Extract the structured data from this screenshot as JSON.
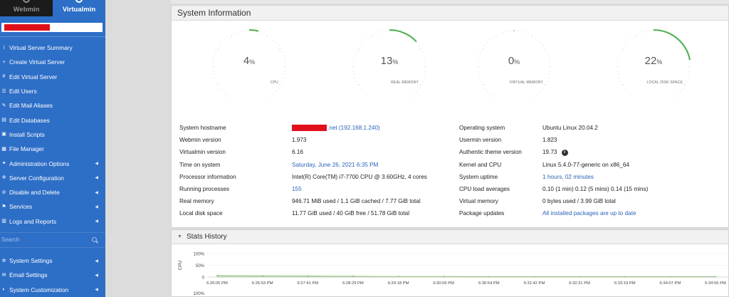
{
  "sidebar": {
    "tabs": [
      {
        "label": "Webmin",
        "active": false
      },
      {
        "label": "Virtualmin",
        "active": true
      }
    ],
    "items": [
      {
        "label": "Virtual Server Summary",
        "icon": "info-circle-icon",
        "arrow": false
      },
      {
        "label": "Create Virtual Server",
        "icon": "create-server-icon",
        "arrow": false
      },
      {
        "label": "Edit Virtual Server",
        "icon": "server-edit-icon",
        "arrow": false
      },
      {
        "label": "Edit Users",
        "icon": "users-icon",
        "arrow": false
      },
      {
        "label": "Edit Mail Aliases",
        "icon": "mail-alias-icon",
        "arrow": false
      },
      {
        "label": "Edit Databases",
        "icon": "database-icon",
        "arrow": false
      },
      {
        "label": "Install Scripts",
        "icon": "install-scripts-icon",
        "arrow": false
      },
      {
        "label": "File Manager",
        "icon": "file-manager-icon",
        "arrow": false
      },
      {
        "label": "Administration Options",
        "icon": "wrench-icon",
        "arrow": true
      },
      {
        "label": "Server Configuration",
        "icon": "cogs-icon",
        "arrow": true
      },
      {
        "label": "Disable and Delete",
        "icon": "delete-icon",
        "arrow": true
      },
      {
        "label": "Services",
        "icon": "services-icon",
        "arrow": true
      },
      {
        "label": "Logs and Reports",
        "icon": "logs-icon",
        "arrow": true
      }
    ],
    "search_placeholder": "Search",
    "bottom_items": [
      {
        "label": "System Settings",
        "icon": "gear-icon",
        "arrow": true
      },
      {
        "label": "Email Settings",
        "icon": "envelope-icon",
        "arrow": true
      },
      {
        "label": "System Customization",
        "icon": "palette-icon",
        "arrow": true
      }
    ]
  },
  "sysinfo": {
    "title": "System Information",
    "gauges": [
      {
        "label": "CPU",
        "value": 4,
        "unit": "%"
      },
      {
        "label": "REAL MEMORY",
        "value": 13,
        "unit": "%"
      },
      {
        "label": "VIRTUAL MEMORY",
        "value": 0,
        "unit": "%"
      },
      {
        "label": "LOCAL DISK SPACE",
        "value": 22,
        "unit": "%"
      }
    ],
    "left": [
      {
        "k": "System hostname",
        "v": ".net (192.168.1.240)",
        "link": true,
        "redacted": true
      },
      {
        "k": "Webmin version",
        "v": "1.973"
      },
      {
        "k": "Virtualmin version",
        "v": "6.16"
      },
      {
        "k": "Time on system",
        "v": "Saturday, June 26, 2021 6:35 PM",
        "link": true
      },
      {
        "k": "Processor information",
        "v": "Intel(R) Core(TM) i7-7700 CPU @ 3.60GHz, 4 cores"
      },
      {
        "k": "Running processes",
        "v": "155",
        "link": true
      },
      {
        "k": "Real memory",
        "v": "946.71 MiB used / 1.1 GiB cached / 7.77 GiB total"
      },
      {
        "k": "Local disk space",
        "v": "11.77 GiB used / 40 GiB free / 51.78 GiB total"
      }
    ],
    "right": [
      {
        "k": "Operating system",
        "v": "Ubuntu Linux 20.04.2"
      },
      {
        "k": "Usermin version",
        "v": "1.823"
      },
      {
        "k": "Authentic theme version",
        "v": "19.73",
        "badge": "i"
      },
      {
        "k": "Kernel and CPU",
        "v": "Linux 5.4.0-77-generic on x86_64"
      },
      {
        "k": "System uptime",
        "v": "1 hours, 02 minutes",
        "link": true
      },
      {
        "k": "CPU load averages",
        "v": "0.10 (1 min) 0.12 (5 mins) 0.14 (15 mins)"
      },
      {
        "k": "Virtual memory",
        "v": "0 bytes used / 3.99 GiB total"
      },
      {
        "k": "Package updates",
        "v": "All installed packages are up to date",
        "link": true
      }
    ]
  },
  "stats": {
    "title": "Stats History",
    "gauge_color": "#4caf50",
    "chart_data": {
      "type": "area",
      "ylabel": "CPU",
      "yticks": [
        "100%",
        "50%",
        "0"
      ],
      "ylim": [
        0,
        100
      ],
      "x": [
        "6:26:05 PM",
        "6:26:53 PM",
        "6:27:41 PM",
        "6:28:29 PM",
        "6:29:18 PM",
        "6:30:06 PM",
        "6:30:54 PM",
        "6:31:42 PM",
        "6:32:31 PM",
        "6:33:19 PM",
        "6:34:07 PM",
        "6:34:55 PM"
      ],
      "series": [
        {
          "values": [
            7,
            6,
            5,
            4,
            3,
            3,
            2,
            2,
            2,
            2,
            2,
            2
          ]
        }
      ],
      "next_panel_tick": "100%"
    }
  }
}
